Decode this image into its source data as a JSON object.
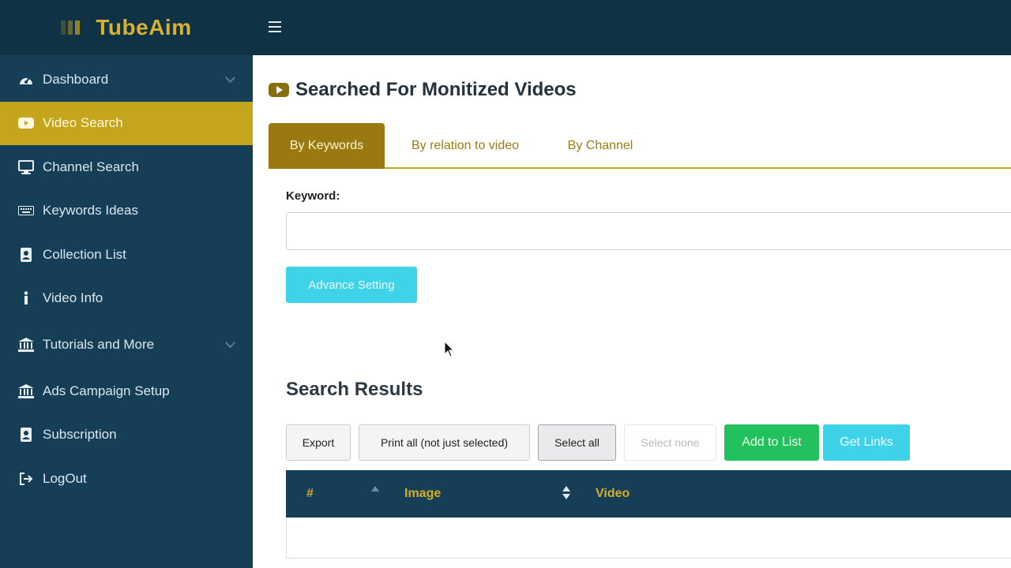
{
  "brand": {
    "name": "TubeAim"
  },
  "sidebar": {
    "items": [
      {
        "label": "Dashboard",
        "icon": "dashboard-icon",
        "has_chevron": true
      },
      {
        "label": "Video Search",
        "icon": "video-icon",
        "active": true
      },
      {
        "label": "Channel Search",
        "icon": "monitor-icon"
      },
      {
        "label": "Keywords Ideas",
        "icon": "keyboard-icon"
      },
      {
        "label": "Collection List",
        "icon": "address-book-icon"
      },
      {
        "label": "Video Info",
        "icon": "info-icon"
      },
      {
        "label": "Tutorials and More",
        "icon": "institution-icon",
        "has_chevron": true
      },
      {
        "label": "Ads Campaign Setup",
        "icon": "institution-icon"
      },
      {
        "label": "Subscription",
        "icon": "address-book-icon"
      },
      {
        "label": "LogOut",
        "icon": "logout-icon"
      }
    ]
  },
  "topbar": {
    "menu_icon": "hamburger-icon"
  },
  "page": {
    "title": "Searched For Monitized Videos",
    "title_icon": "youtube-icon"
  },
  "tabs": [
    {
      "label": "By Keywords",
      "active": true
    },
    {
      "label": "By relation to video"
    },
    {
      "label": "By Channel"
    }
  ],
  "form": {
    "keyword_label": "Keyword:",
    "keyword_value": "",
    "advance_setting_label": "Advance Setting"
  },
  "results": {
    "title": "Search Results",
    "buttons": {
      "export": "Export",
      "print_all": "Print all (not just selected)",
      "select_all": "Select all",
      "select_none": "Select none",
      "add_to_list": "Add to List",
      "get_links": "Get Links"
    },
    "columns": [
      "#",
      "Image",
      "Video"
    ]
  },
  "colors": {
    "sidebar_bg": "#163f57",
    "topbar_bg": "#0f3344",
    "accent_gold": "#c5a51c",
    "cyan_button": "#3fd3ea",
    "green_button": "#22c15e"
  }
}
